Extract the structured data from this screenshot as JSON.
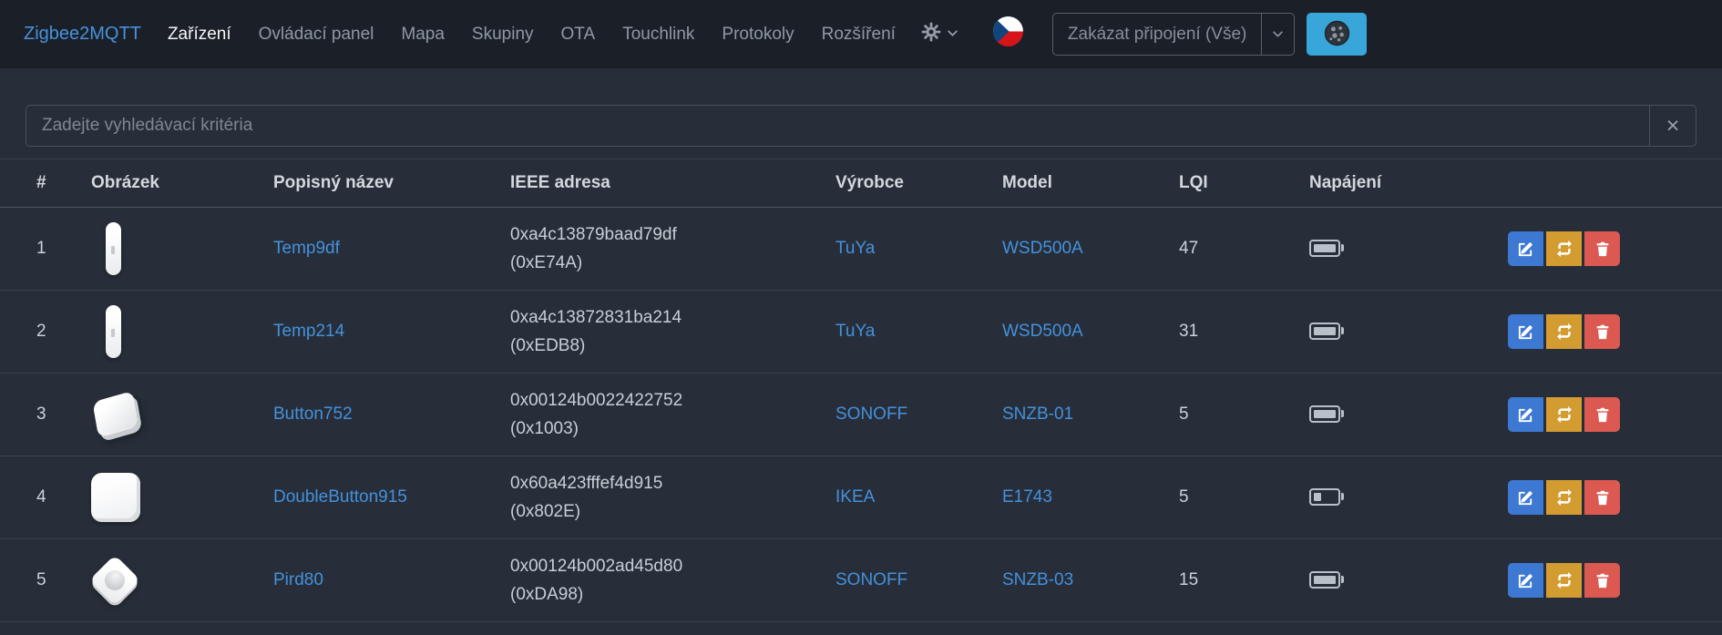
{
  "navbar": {
    "brand": "Zigbee2MQTT",
    "items": [
      {
        "label": "Zařízení",
        "active": true
      },
      {
        "label": "Ovládací panel",
        "active": false
      },
      {
        "label": "Mapa",
        "active": false
      },
      {
        "label": "Skupiny",
        "active": false
      },
      {
        "label": "OTA",
        "active": false
      },
      {
        "label": "Touchlink",
        "active": false
      },
      {
        "label": "Protokoly",
        "active": false
      },
      {
        "label": "Rozšíření",
        "active": false
      }
    ],
    "permit_join_select": {
      "selected": "Zakázat připojení (Vše)"
    }
  },
  "search": {
    "placeholder": "Zadejte vyhledávací kritéria",
    "clear_label": "×"
  },
  "table": {
    "headers": [
      "#",
      "Obrázek",
      "Popisný název",
      "IEEE adresa",
      "Výrobce",
      "Model",
      "LQI",
      "Napájení"
    ],
    "rows": [
      {
        "index": "1",
        "image": "pill",
        "name": "Temp9df",
        "ieee": "0xa4c13879baad79df",
        "network": "(0xE74A)",
        "vendor": "TuYa",
        "model": "WSD500A",
        "lqi": "47",
        "battery": "full"
      },
      {
        "index": "2",
        "image": "pill",
        "name": "Temp214",
        "ieee": "0xa4c13872831ba214",
        "network": "(0xEDB8)",
        "vendor": "TuYa",
        "model": "WSD500A",
        "lqi": "31",
        "battery": "full"
      },
      {
        "index": "3",
        "image": "button-tilted",
        "name": "Button752",
        "ieee": "0x00124b0022422752",
        "network": "(0x1003)",
        "vendor": "SONOFF",
        "model": "SNZB-01",
        "lqi": "5",
        "battery": "full"
      },
      {
        "index": "4",
        "image": "square",
        "name": "DoubleButton915",
        "ieee": "0x60a423fffef4d915",
        "network": "(0x802E)",
        "vendor": "IKEA",
        "model": "E1743",
        "lqi": "5",
        "battery": "low"
      },
      {
        "index": "5",
        "image": "dome",
        "name": "Pird80",
        "ieee": "0x00124b002ad45d80",
        "network": "(0xDA98)",
        "vendor": "SONOFF",
        "model": "SNZB-03",
        "lqi": "15",
        "battery": "full"
      }
    ]
  },
  "icons": {
    "gear": "settings gear",
    "chevron_down": "dropdown caret",
    "czech_flag": "language flag (Czech)",
    "permit_join": "dark circle with nodes",
    "edit": "pencil-square",
    "reconfigure": "retweet arrows",
    "delete": "trash can",
    "battery_full": "full battery",
    "battery_low": "low battery"
  },
  "colors": {
    "navbar_bg": "#1b2028",
    "page_bg": "#272e39",
    "link": "#4491dc",
    "info": "#38a6d8",
    "primary": "#3d78d3",
    "warning": "#d39c31",
    "danger": "#dc5952",
    "border": "#3b4251"
  }
}
